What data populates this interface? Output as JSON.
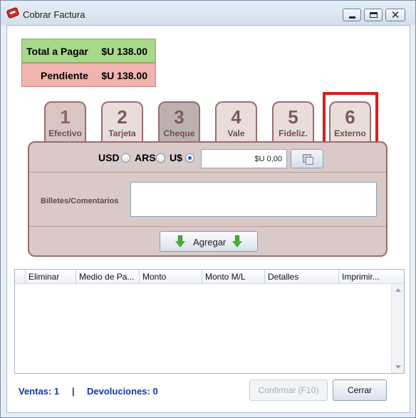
{
  "window": {
    "title": "Cobrar Factura",
    "app_icon": "invoice-tag-icon",
    "controls": {
      "minimize": "minimize-icon",
      "maximize": "maximize-icon",
      "close_glyph": "✕"
    }
  },
  "summary": {
    "total_label": "Total a Pagar",
    "total_amount": "$U 138.00",
    "pending_label": "Pendiente",
    "pending_amount": "$U 138.00",
    "colors": {
      "total_bg": "#a8d88a",
      "pending_bg": "#f0b3ad"
    }
  },
  "tabs": [
    {
      "number": "1",
      "label": "Efectivo",
      "state": "active"
    },
    {
      "number": "2",
      "label": "Tarjeta",
      "state": "normal"
    },
    {
      "number": "3",
      "label": "Cheque",
      "state": "disabled"
    },
    {
      "number": "4",
      "label": "Vale",
      "state": "normal"
    },
    {
      "number": "5",
      "label": "Fideliz.",
      "state": "normal"
    },
    {
      "number": "6",
      "label": "Externo",
      "state": "highlighted"
    }
  ],
  "payment_panel": {
    "currencies": [
      {
        "label": "USD",
        "selected": false
      },
      {
        "label": "ARS",
        "selected": false
      },
      {
        "label": "U$",
        "selected": true
      }
    ],
    "amount_value": "$U 0,00",
    "calculator_icon": "calculator-icon",
    "comments_label": "Billetes/Comentarios",
    "comments_value": "",
    "add_label": "Agregar",
    "add_icon": "green-down-arrow-icon"
  },
  "grid": {
    "columns": [
      "Eliminar",
      "Medio de Pa...",
      "Monto",
      "Monto M/L",
      "Detalles",
      "Imprimir..."
    ],
    "rows": []
  },
  "footer": {
    "sales": "Ventas: 1",
    "separator": "|",
    "returns": "Devoluciones: 0",
    "confirm_label": "Confirmar (F10)",
    "close_label": "Cerrar"
  }
}
